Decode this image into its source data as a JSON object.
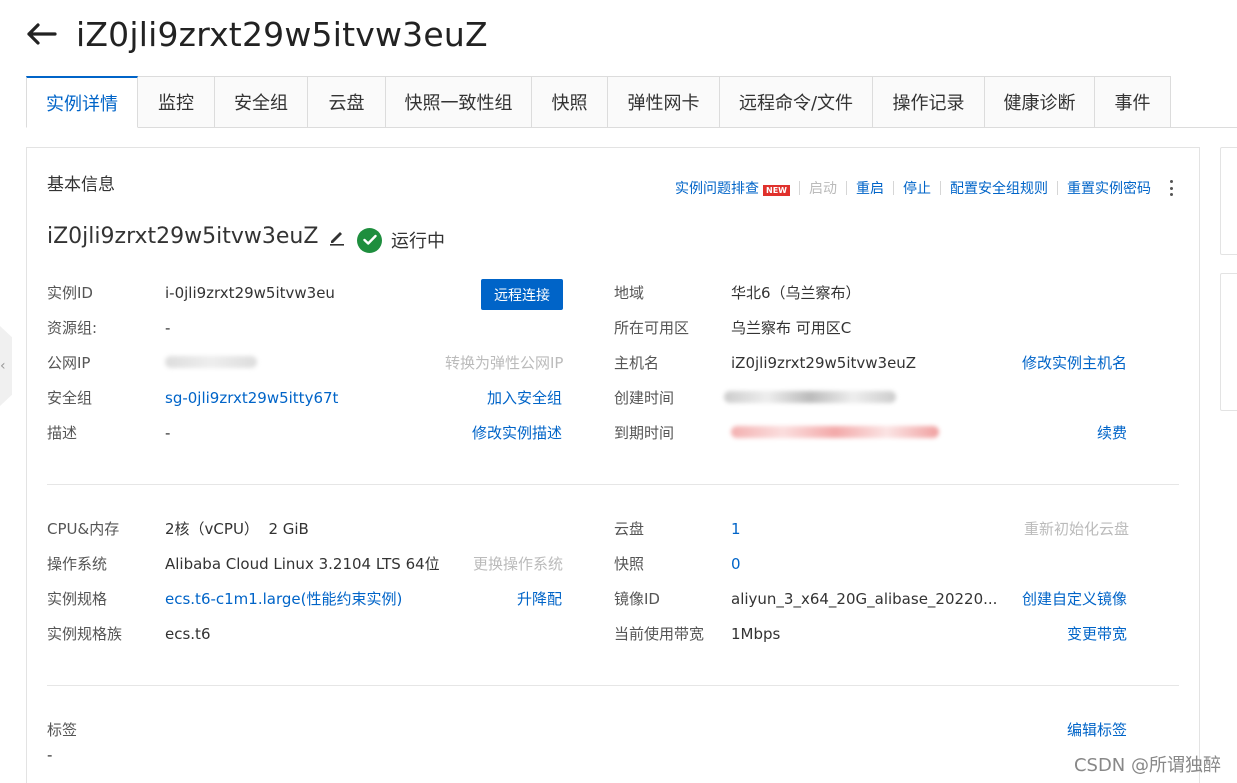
{
  "header": {
    "title": "iZ0jli9zrxt29w5itvw3euZ"
  },
  "tabs": [
    "实例详情",
    "监控",
    "安全组",
    "云盘",
    "快照一致性组",
    "快照",
    "弹性网卡",
    "远程命令/文件",
    "操作记录",
    "健康诊断",
    "事件"
  ],
  "basic": {
    "section_title": "基本信息",
    "actions": {
      "troubleshoot": "实例问题排查",
      "new_badge": "NEW",
      "start": "启动",
      "restart": "重启",
      "stop": "停止",
      "config_sg": "配置安全组规则",
      "reset_pwd": "重置实例密码"
    },
    "instance_name": "iZ0jli9zrxt29w5itvw3euZ",
    "status": "运行中"
  },
  "info_left": {
    "instance_id": {
      "label": "实例ID",
      "value": "i-0jli9zrxt29w5itvw3eu",
      "button": "远程连接"
    },
    "resource_group": {
      "label": "资源组:",
      "value": "-"
    },
    "public_ip": {
      "label": "公网IP",
      "action": "转换为弹性公网IP"
    },
    "security_group": {
      "label": "安全组",
      "value": "sg-0jli9zrxt29w5itty67t",
      "action": "加入安全组"
    },
    "description": {
      "label": "描述",
      "value": "-",
      "action": "修改实例描述"
    }
  },
  "info_right": {
    "region": {
      "label": "地域",
      "value": "华北6（乌兰察布）"
    },
    "zone": {
      "label": "所在可用区",
      "value": "乌兰察布 可用区C"
    },
    "hostname": {
      "label": "主机名",
      "value": "iZ0jli9zrxt29w5itvw3euZ",
      "action": "修改实例主机名"
    },
    "created": {
      "label": "创建时间"
    },
    "expires": {
      "label": "到期时间",
      "action": "续费"
    }
  },
  "spec_left": {
    "cpu_mem": {
      "label": "CPU&内存",
      "value": "2核（vCPU）  2 GiB"
    },
    "os": {
      "label": "操作系统",
      "value": "Alibaba Cloud Linux 3.2104 LTS 64位",
      "action": "更换操作系统"
    },
    "type": {
      "label": "实例规格",
      "value": "ecs.t6-c1m1.large(性能约束实例)",
      "action": "升降配"
    },
    "family": {
      "label": "实例规格族",
      "value": "ecs.t6"
    }
  },
  "spec_right": {
    "disk": {
      "label": "云盘",
      "value": "1",
      "action": "重新初始化云盘"
    },
    "snapshot": {
      "label": "快照",
      "value": "0"
    },
    "image": {
      "label": "镜像ID",
      "value": "aliyun_3_x64_20G_alibase_20220...",
      "action": "创建自定义镜像"
    },
    "bandwidth": {
      "label": "当前使用带宽",
      "value": "1Mbps",
      "action": "变更带宽"
    }
  },
  "tags": {
    "label": "标签",
    "value": "-",
    "action": "编辑标签"
  },
  "watermark": "CSDN @所谓独醉"
}
